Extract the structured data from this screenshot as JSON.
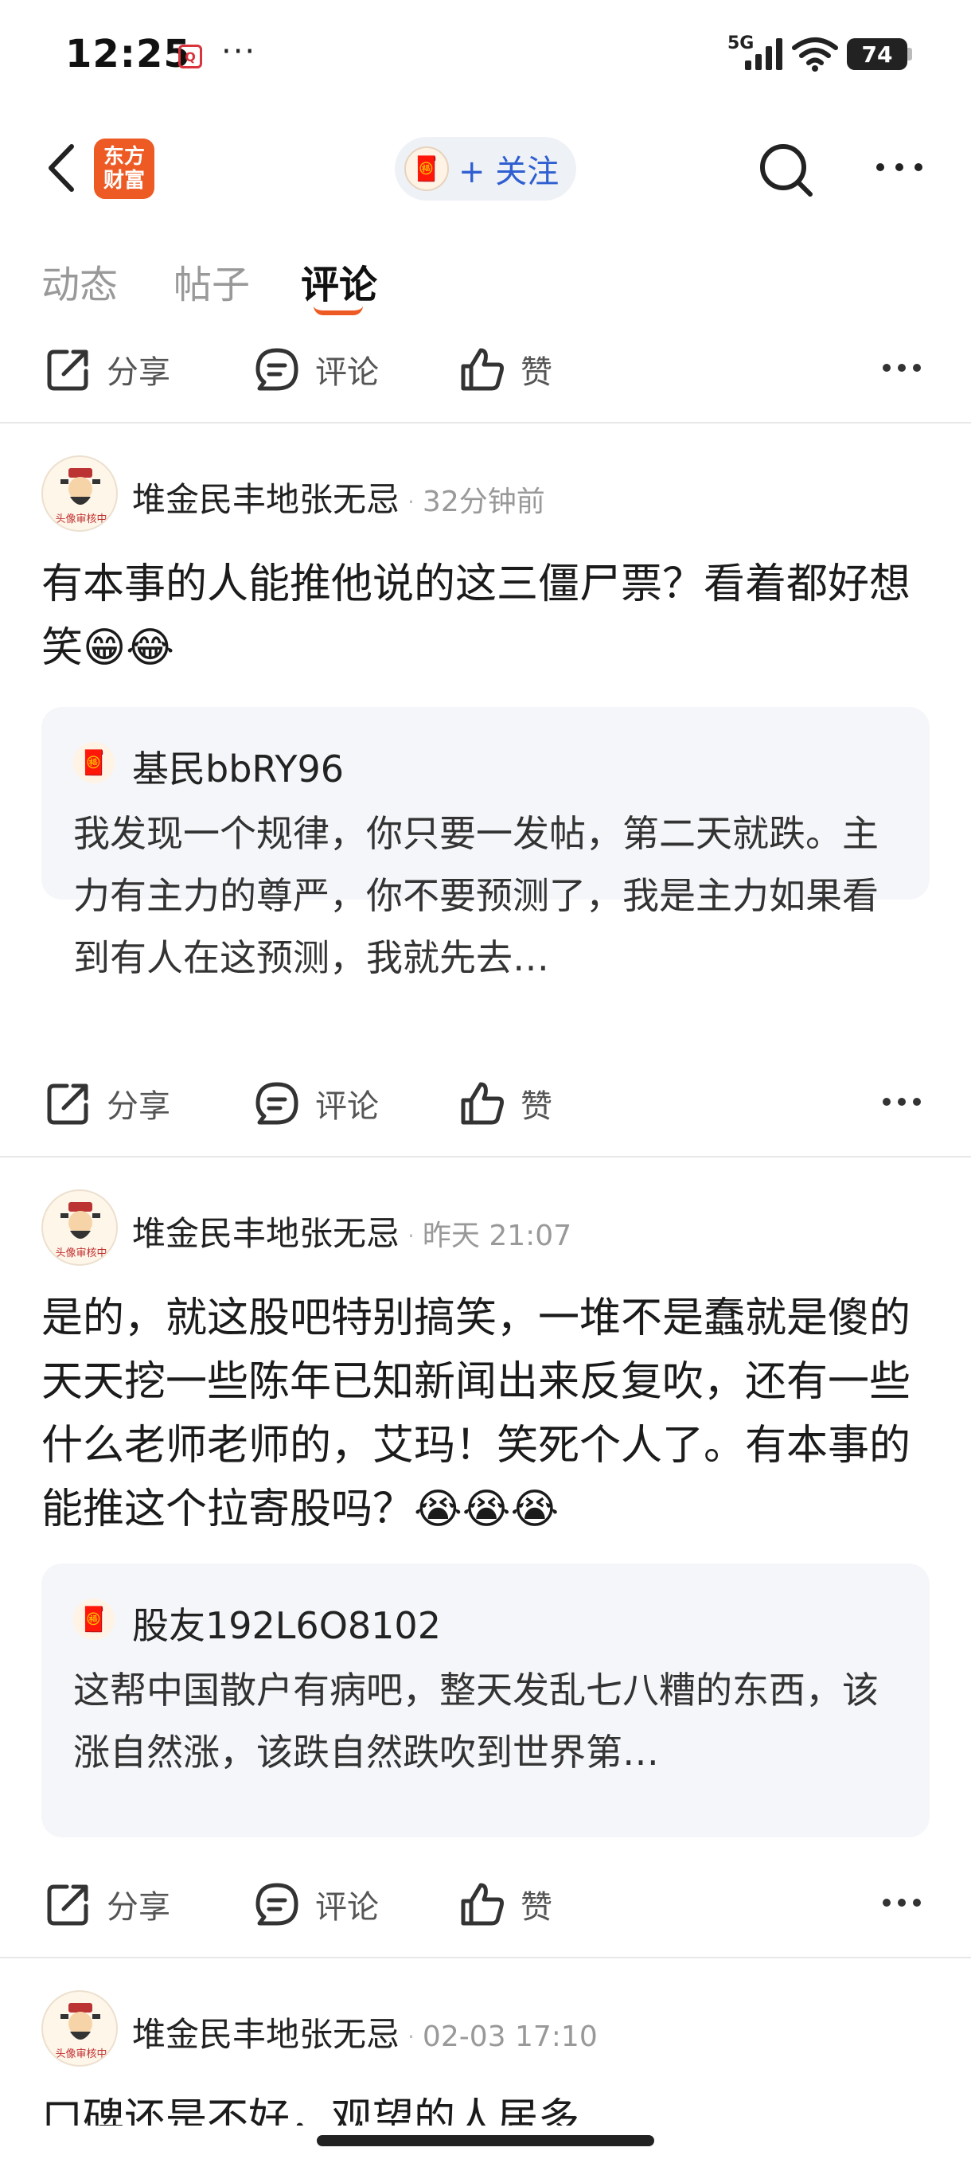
{
  "status": {
    "time": "12:25",
    "notif": "Q",
    "dots": "···",
    "network": "5G",
    "battery": "74"
  },
  "nav": {
    "logo_text": "东方\n财富",
    "follow_label": "+ 关注"
  },
  "tabs": [
    {
      "label": "动态"
    },
    {
      "label": "帖子"
    },
    {
      "label": "评论"
    }
  ],
  "actions": {
    "share": "分享",
    "comment": "评论",
    "like": "赞"
  },
  "posts": [
    {
      "author": "堆金民丰地张无忌",
      "time": "32分钟前",
      "avatar_text": "头像审核中",
      "text": "有本事的人能推他说的这三僵尸票？看着都好想笑😁😂",
      "quote": {
        "name": "基民bbRY96",
        "text": "我发现一个规律，你只要一发帖，第二天就跌。主力有主力的尊严，你不要预测了，我是主力如果看到有人在这预测，我就先去…"
      }
    },
    {
      "author": "堆金民丰地张无忌",
      "time": "昨天 21:07",
      "avatar_text": "头像审核中",
      "text": "是的，就这股吧特别搞笑，一堆不是蠢就是傻的天天挖一些陈年已知新闻出来反复吹，还有一些什么老师老师的，艾玛！笑死个人了。有本事的能推这个拉寄股吗？😭😭😭",
      "quote": {
        "name": "股友192L6O8102",
        "text": "这帮中国散户有病吧，整天发乱七八糟的东西，该涨自然涨，该跌自然跌吹到世界第…"
      }
    },
    {
      "author": "堆金民丰地张无忌",
      "time": "02-03 17:10",
      "avatar_text": "头像审核中",
      "text": "口碑还是不好，观望的人居多"
    }
  ]
}
